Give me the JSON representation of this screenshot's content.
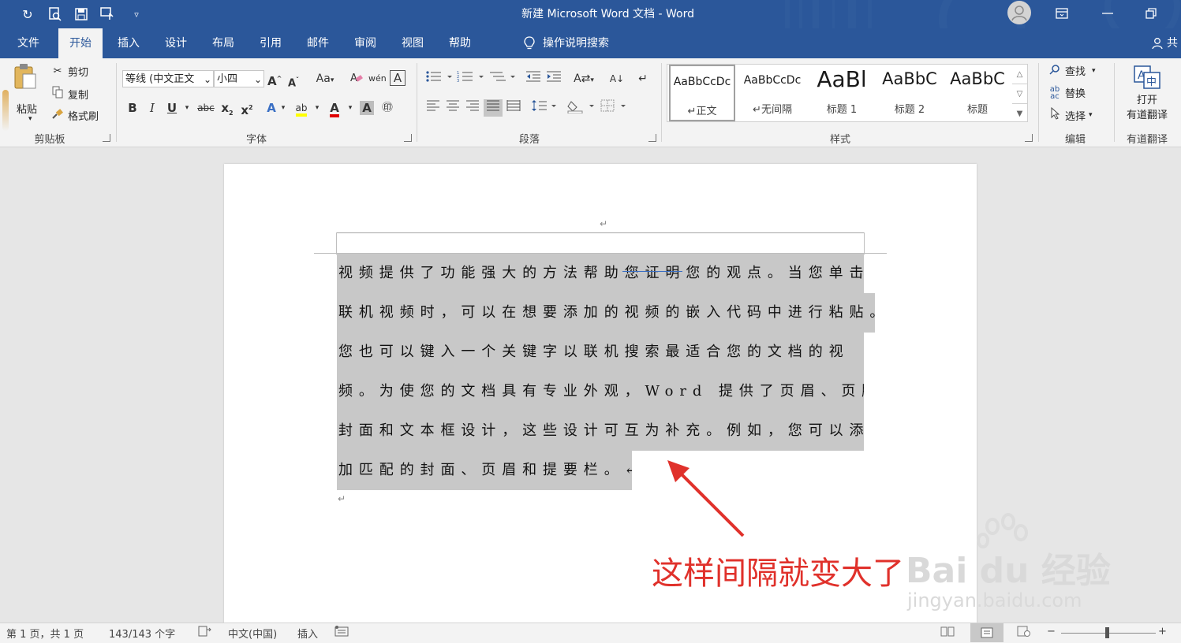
{
  "titlebar": {
    "title": "新建 Microsoft Word 文档  -  Word",
    "quick_access": [
      "undo-icon",
      "print-preview-icon",
      "save-icon",
      "touch-mode-icon",
      "customize-icon"
    ]
  },
  "tabs": [
    "文件",
    "开始",
    "插入",
    "设计",
    "布局",
    "引用",
    "邮件",
    "审阅",
    "视图",
    "帮助"
  ],
  "active_tab": "开始",
  "tell_me": "操作说明搜索",
  "share_label": "共",
  "clipboard": {
    "paste": "粘贴",
    "cut": "剪切",
    "copy": "复制",
    "format_painter": "格式刷",
    "label": "剪贴板"
  },
  "font": {
    "name": "等线 (中文正文",
    "size": "小四",
    "label": "字体",
    "case_btn": "Aa"
  },
  "paragraph": {
    "label": "段落"
  },
  "styles": {
    "label": "样式",
    "items": [
      {
        "sample": "AaBbCcDc",
        "name": "正文",
        "mark": "↵"
      },
      {
        "sample": "AaBbCcDc",
        "name": "无间隔",
        "mark": "↵"
      },
      {
        "sample": "AaBl",
        "name": "标题 1"
      },
      {
        "sample": "AaBbC",
        "name": "标题 2"
      },
      {
        "sample": "AaBbC",
        "name": "标题"
      }
    ]
  },
  "editing": {
    "find": "查找",
    "replace": "替换",
    "select": "选择",
    "label": "编辑"
  },
  "youdao": {
    "open_line1": "打开",
    "open_line2": "有道翻译",
    "label": "有道翻译"
  },
  "document": {
    "lines": [
      "视频提供了功能强大的方法帮助您证明您的观点。当您单击",
      "联机视频时，可以在想要添加的视频的嵌入代码中进行粘贴。",
      "您也可以键入一个关键字以联机搜索最适合您的文档的视",
      "频。为使您的文档具有专业外观，Word 提供了页眉、页脚、",
      "封面和文本框设计，这些设计可互为补充。例如，您可以添",
      "加匹配的封面、页眉和提要栏。↵"
    ],
    "para_mark": "↵"
  },
  "annotation": "这样间隔就变大了",
  "watermark": {
    "brand": "Bai du 经验",
    "url": "jingyan.baidu.com"
  },
  "statusbar": {
    "page": "第 1 页，共 1 页",
    "words": "143/143 个字",
    "language": "中文(中国)",
    "mode": "插入",
    "zoom_minus": "−",
    "zoom_plus": "+"
  },
  "colors": {
    "word_blue": "#2b579a",
    "ribbon_bg": "#f3f3f3",
    "selection": "#c8c8c8",
    "annotation_red": "#e0312b",
    "font_color_red": "#e00000",
    "highlight_yellow": "#ffff00"
  }
}
